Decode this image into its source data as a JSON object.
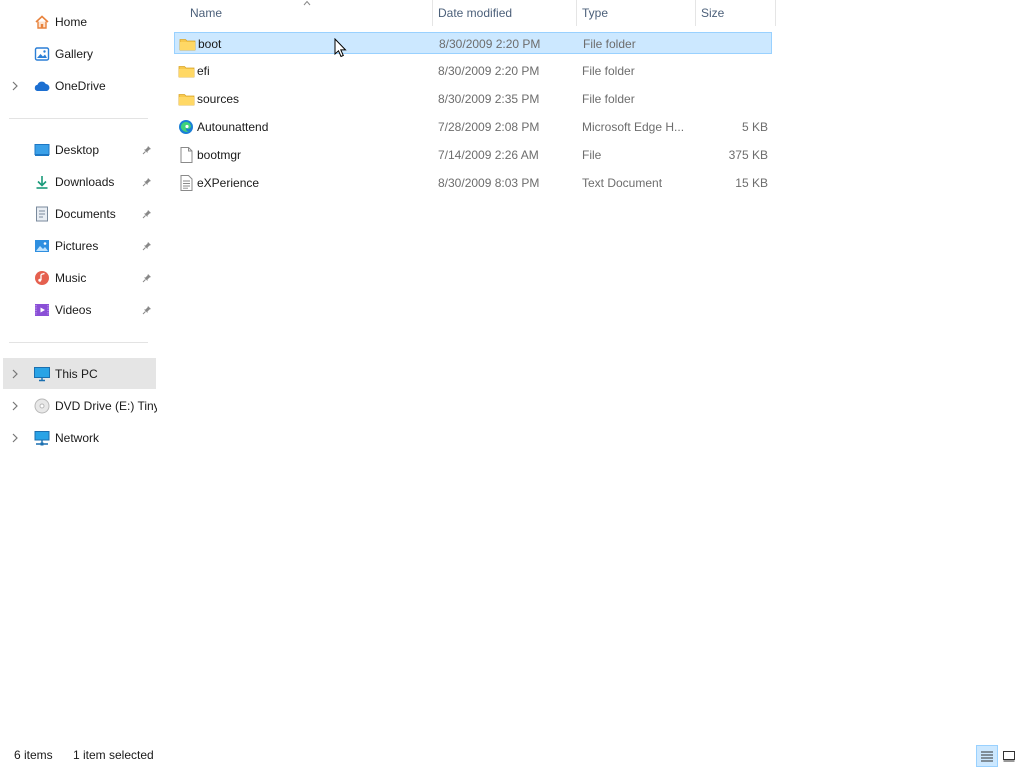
{
  "sidebar": {
    "items": [
      {
        "label": "Home",
        "icon": "home-icon"
      },
      {
        "label": "Gallery",
        "icon": "gallery-icon"
      },
      {
        "label": "OneDrive",
        "icon": "onedrive-icon"
      },
      {
        "label": "Desktop",
        "icon": "desktop-icon"
      },
      {
        "label": "Downloads",
        "icon": "downloads-icon"
      },
      {
        "label": "Documents",
        "icon": "documents-icon"
      },
      {
        "label": "Pictures",
        "icon": "pictures-icon"
      },
      {
        "label": "Music",
        "icon": "music-icon"
      },
      {
        "label": "Videos",
        "icon": "videos-icon"
      },
      {
        "label": "This PC",
        "icon": "this-pc-icon",
        "selected": true
      },
      {
        "label": "DVD Drive (E:) TinyXP",
        "icon": "dvd-drive-icon"
      },
      {
        "label": "Network",
        "icon": "network-icon"
      }
    ]
  },
  "columns": {
    "name": "Name",
    "date": "Date modified",
    "type": "Type",
    "size": "Size"
  },
  "files": [
    {
      "name": "boot",
      "date": "8/30/2009 2:20 PM",
      "type": "File folder",
      "size": "",
      "icon": "folder-icon",
      "selected": true
    },
    {
      "name": "efi",
      "date": "8/30/2009 2:20 PM",
      "type": "File folder",
      "size": "",
      "icon": "folder-icon"
    },
    {
      "name": "sources",
      "date": "8/30/2009 2:35 PM",
      "type": "File folder",
      "size": "",
      "icon": "folder-icon"
    },
    {
      "name": "Autounattend",
      "date": "7/28/2009 2:08 PM",
      "type": "Microsoft Edge H...",
      "size": "5 KB",
      "icon": "edge-icon"
    },
    {
      "name": "bootmgr",
      "date": "7/14/2009 2:26 AM",
      "type": "File",
      "size": "375 KB",
      "icon": "file-icon"
    },
    {
      "name": "eXPerience",
      "date": "8/30/2009 8:03 PM",
      "type": "Text Document",
      "size": "15 KB",
      "icon": "text-file-icon"
    }
  ],
  "status": {
    "item_count": "6 items",
    "selection": "1 item selected"
  },
  "colors": {
    "selection_bg": "#cce8ff",
    "selection_border": "#99d1ff",
    "nav_selected_bg": "#e5e5e5",
    "folder_yellow": "#f8c94c"
  }
}
